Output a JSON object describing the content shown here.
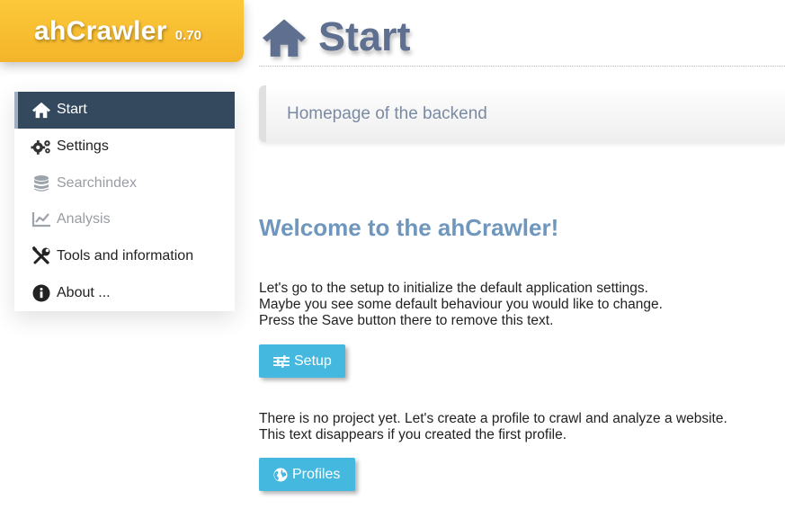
{
  "app": {
    "name": "ahCrawler",
    "version": "0.70"
  },
  "sidebar": {
    "items": [
      {
        "label": "Start",
        "icon": "home-icon",
        "state": "active"
      },
      {
        "label": "Settings",
        "icon": "gears-icon",
        "state": "normal"
      },
      {
        "label": "Searchindex",
        "icon": "database-icon",
        "state": "disabled"
      },
      {
        "label": "Analysis",
        "icon": "chart-icon",
        "state": "disabled"
      },
      {
        "label": "Tools and information",
        "icon": "tools-icon",
        "state": "normal"
      },
      {
        "label": "About ...",
        "icon": "info-icon",
        "state": "normal"
      }
    ]
  },
  "header": {
    "title": "Start",
    "subtitle": "Homepage of the backend",
    "icon": "home-icon"
  },
  "main": {
    "welcome": "Welcome to the ahCrawler!",
    "setup_text": [
      "Let's go to the setup to initialize the default application settings.",
      "Maybe you see some default behaviour you would like to change.",
      "Press the Save button there to remove this text."
    ],
    "setup_button": "Setup",
    "profile_text": [
      "There is no project yet. Let's create a profile to crawl and analyze a website.",
      "This text disappears if you created the first profile."
    ],
    "profiles_button": "Profiles"
  },
  "colors": {
    "accent": "#f4b42a",
    "sidebar_active": "#34495e",
    "button": "#45b8df",
    "title": "#5e6f90",
    "welcome": "#6f96bd"
  }
}
